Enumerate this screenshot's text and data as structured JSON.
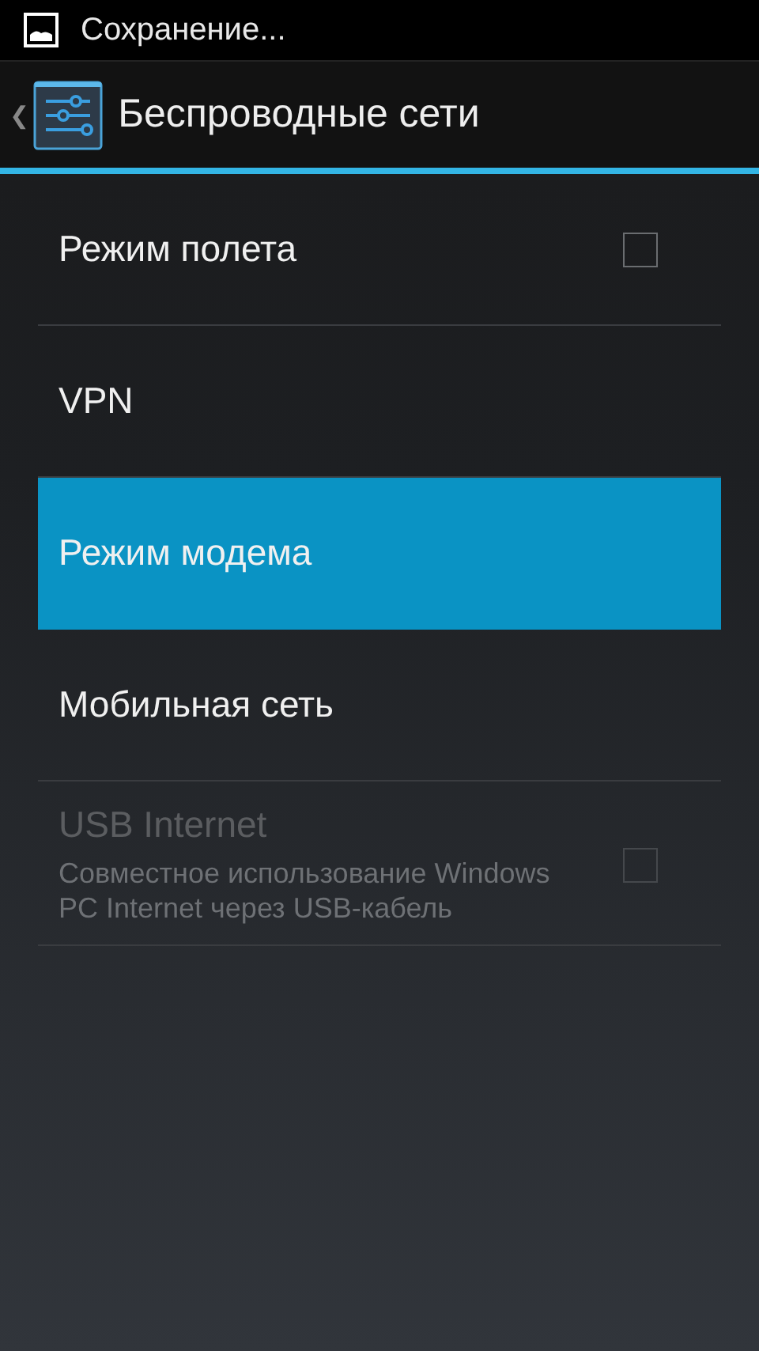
{
  "status_bar": {
    "notification": "Сохранение..."
  },
  "action_bar": {
    "back": "❮",
    "title": "Беспроводные сети"
  },
  "items": [
    {
      "kind": "checkbox",
      "title": "Режим полета",
      "checked": false,
      "selected": false,
      "disabled": false
    },
    {
      "kind": "plain",
      "title": "VPN",
      "selected": false,
      "disabled": false
    },
    {
      "kind": "plain",
      "title": "Режим модема",
      "selected": true,
      "disabled": false
    },
    {
      "kind": "plain",
      "title": "Мобильная сеть",
      "selected": false,
      "disabled": false
    },
    {
      "kind": "checkbox",
      "title": "USB Internet",
      "summary": "Совместное использование Windows PC Internet через USB-кабель",
      "checked": false,
      "selected": false,
      "disabled": true
    }
  ]
}
